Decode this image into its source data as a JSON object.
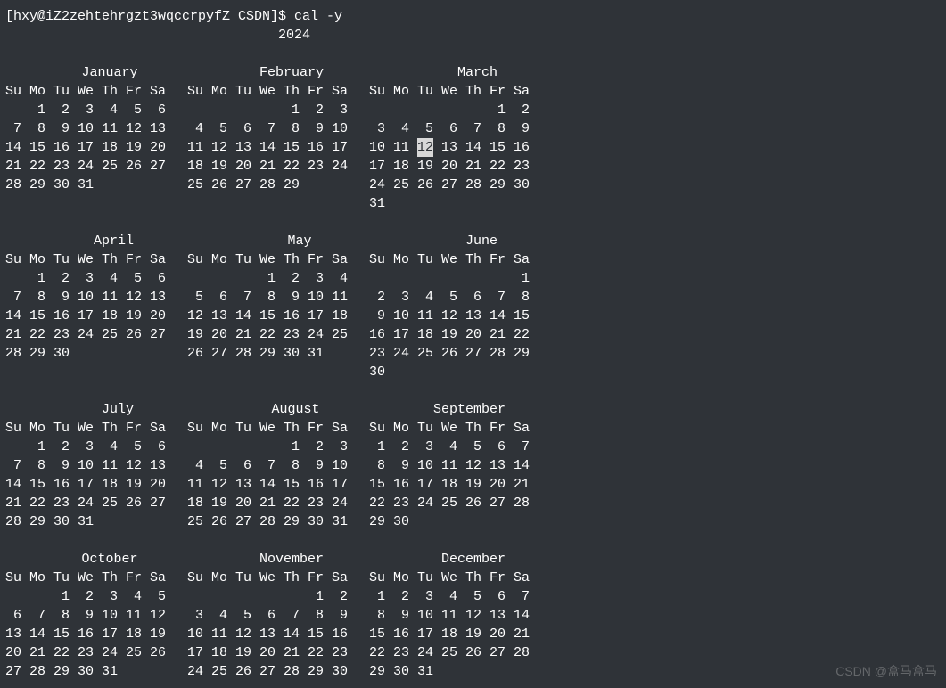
{
  "prompt": "[hxy@iZ2zehtehrgzt3wqccrpyfZ CSDN]$ cal -y",
  "year_line": "                                  2024",
  "watermark": "CSDN @盒马盒马",
  "day_headers": [
    "Su",
    "Mo",
    "Tu",
    "We",
    "Th",
    "Fr",
    "Sa"
  ],
  "today": {
    "month": 2,
    "day": 12
  },
  "months": [
    {
      "name": "January",
      "start": 1,
      "days": 31
    },
    {
      "name": "February",
      "start": 4,
      "days": 29
    },
    {
      "name": "March",
      "start": 5,
      "days": 31
    },
    {
      "name": "April",
      "start": 1,
      "days": 30
    },
    {
      "name": "May",
      "start": 3,
      "days": 31
    },
    {
      "name": "June",
      "start": 6,
      "days": 30
    },
    {
      "name": "July",
      "start": 1,
      "days": 31
    },
    {
      "name": "August",
      "start": 4,
      "days": 31
    },
    {
      "name": "September",
      "start": 0,
      "days": 30
    },
    {
      "name": "October",
      "start": 2,
      "days": 31
    },
    {
      "name": "November",
      "start": 5,
      "days": 30
    },
    {
      "name": "December",
      "start": 0,
      "days": 31
    }
  ]
}
